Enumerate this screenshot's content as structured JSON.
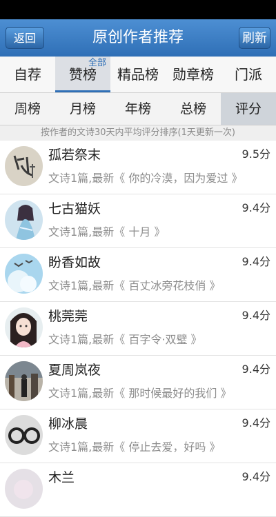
{
  "header": {
    "title": "原创作者推荐",
    "back_label": "返回",
    "refresh_label": "刷新"
  },
  "primary_tabs": [
    {
      "label": "自荐",
      "active": false
    },
    {
      "label": "赞榜",
      "active": true,
      "badge": "全部"
    },
    {
      "label": "精品榜",
      "active": false
    },
    {
      "label": "勋章榜",
      "active": false
    },
    {
      "label": "门派",
      "active": false
    }
  ],
  "secondary_tabs": [
    {
      "label": "周榜",
      "active": false
    },
    {
      "label": "月榜",
      "active": false
    },
    {
      "label": "年榜",
      "active": false
    },
    {
      "label": "总榜",
      "active": false
    },
    {
      "label": "评分",
      "active": true
    }
  ],
  "subtitle": "按作者的文诗30天内平均评分排序(1天更新一次)",
  "authors": [
    {
      "name": "孤若祭末",
      "desc": "文诗1篇,最新《 你的冷漠，因为爱过 》",
      "score": "9.5分"
    },
    {
      "name": "七古猫妖",
      "desc": "文诗1篇,最新《 十月 》",
      "score": "9.4分"
    },
    {
      "name": "盼香如故",
      "desc": "文诗1篇,最新《 百丈冰旁花枝俏 》",
      "score": "9.4分"
    },
    {
      "name": "桃莞莞",
      "desc": "文诗1篇,最新《 百字令·双璧 》",
      "score": "9.4分"
    },
    {
      "name": "夏周岚夜",
      "desc": "文诗1篇,最新《 那时候最好的我们 》",
      "score": "9.4分"
    },
    {
      "name": "柳冰晨",
      "desc": "文诗1篇,最新《 停止去爱，好吗 》",
      "score": "9.4分"
    },
    {
      "name": "木兰",
      "desc": "",
      "score": "9.4分"
    }
  ]
}
